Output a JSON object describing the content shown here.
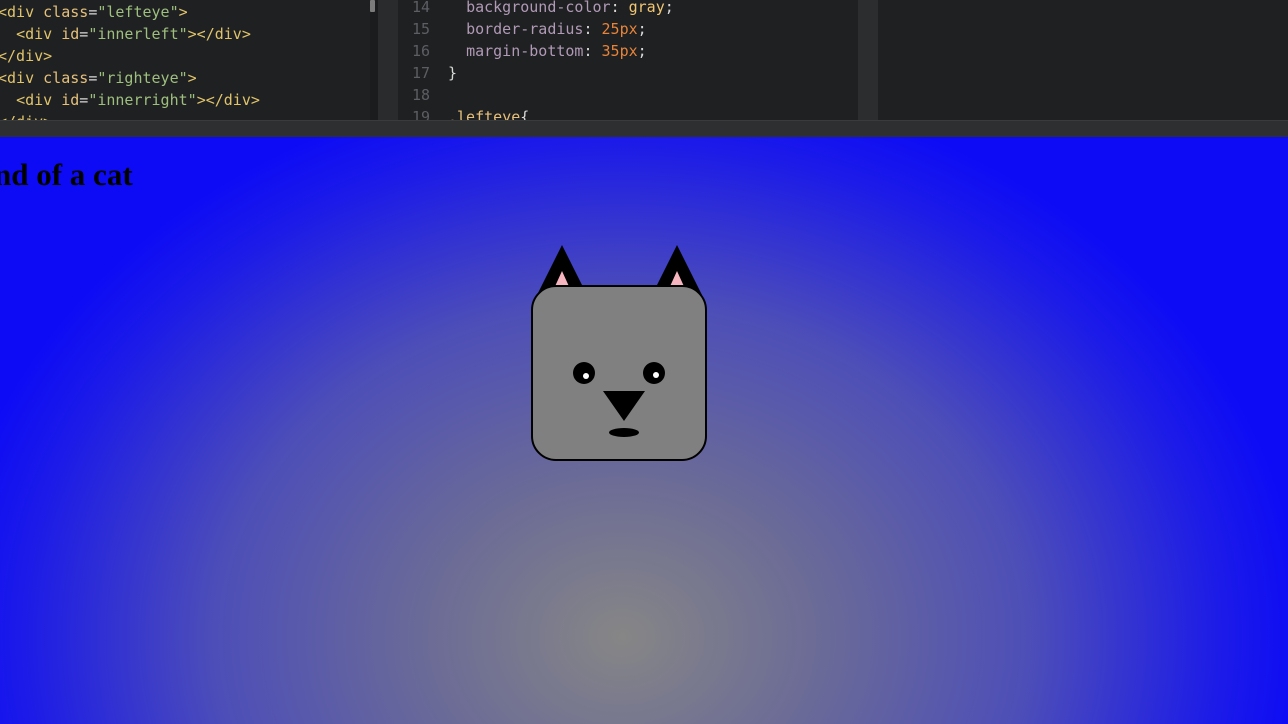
{
  "editor": {
    "html_lines": [
      {
        "indent": "",
        "tag_open": "<div ",
        "attr": "class",
        "eq": "=",
        "value": "\"lefteye\"",
        "close": ">"
      },
      {
        "indent": "  ",
        "tag_open": "<div ",
        "attr": "id",
        "eq": "=",
        "value": "\"innerleft\"",
        "close": "></div>"
      },
      {
        "indent": "",
        "text": "</div>"
      },
      {
        "indent": "",
        "tag_open": "<div ",
        "attr": "class",
        "eq": "=",
        "value": "\"righteye\"",
        "close": ">"
      },
      {
        "indent": "  ",
        "tag_open": "<div ",
        "attr": "id",
        "eq": "=",
        "value": "\"innerright\"",
        "close": "></div>"
      },
      {
        "indent": "",
        "text": "</div>"
      }
    ],
    "css_lines": [
      {
        "num": "14",
        "prop": "background-color",
        "value": "gray",
        "value_type": "kw"
      },
      {
        "num": "15",
        "prop": "border-radius",
        "value": "25px",
        "value_type": "num"
      },
      {
        "num": "16",
        "prop": "margin-bottom",
        "value": "35px",
        "value_type": "num"
      },
      {
        "num": "17",
        "text": "}"
      },
      {
        "num": "18",
        "text": ""
      },
      {
        "num": "19",
        "text": ".lefteye{"
      }
    ]
  },
  "preview": {
    "title": "nd of a cat"
  },
  "colors": {
    "cat_head": "#808080",
    "ear_inner": "#f7b6bf",
    "background_edge": "#0d0bf5",
    "background_center": "#868686"
  }
}
